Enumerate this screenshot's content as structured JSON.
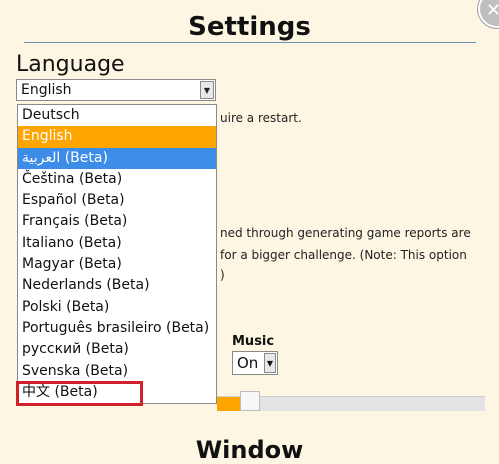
{
  "page": {
    "title": "Settings",
    "window_heading": "Window"
  },
  "language": {
    "label": "Language",
    "selected_value": "English",
    "options": [
      {
        "label": "Deutsch",
        "state": "normal"
      },
      {
        "label": "English",
        "state": "hover"
      },
      {
        "label": "العربية (Beta)",
        "state": "selected"
      },
      {
        "label": "Čeština (Beta)",
        "state": "normal"
      },
      {
        "label": "Español (Beta)",
        "state": "normal"
      },
      {
        "label": "Français (Beta)",
        "state": "normal"
      },
      {
        "label": "Italiano (Beta)",
        "state": "normal"
      },
      {
        "label": "Magyar (Beta)",
        "state": "normal"
      },
      {
        "label": "Nederlands (Beta)",
        "state": "normal"
      },
      {
        "label": "Polski (Beta)",
        "state": "normal"
      },
      {
        "label": "Português brasileiro (Beta)",
        "state": "normal"
      },
      {
        "label": "русский (Beta)",
        "state": "normal"
      },
      {
        "label": "Svenska (Beta)",
        "state": "normal"
      },
      {
        "label": "中文 (Beta)",
        "state": "normal"
      }
    ]
  },
  "background_text": {
    "restart_note": "uire a restart.",
    "reports_line1": "ned through generating game reports are",
    "reports_line2": "for a bigger challenge. (Note: This option",
    "reports_line3": ")"
  },
  "music": {
    "label": "Music",
    "value": "On"
  },
  "slider": {
    "level_fraction": 0.11
  },
  "colors": {
    "background": "#fdf6e3",
    "hover": "#ffa500",
    "selected": "#3d8de8",
    "highlight_box": "#d0202a"
  },
  "icons": {
    "close": "close-icon",
    "dropdown_arrow": "chevron-down-icon"
  }
}
